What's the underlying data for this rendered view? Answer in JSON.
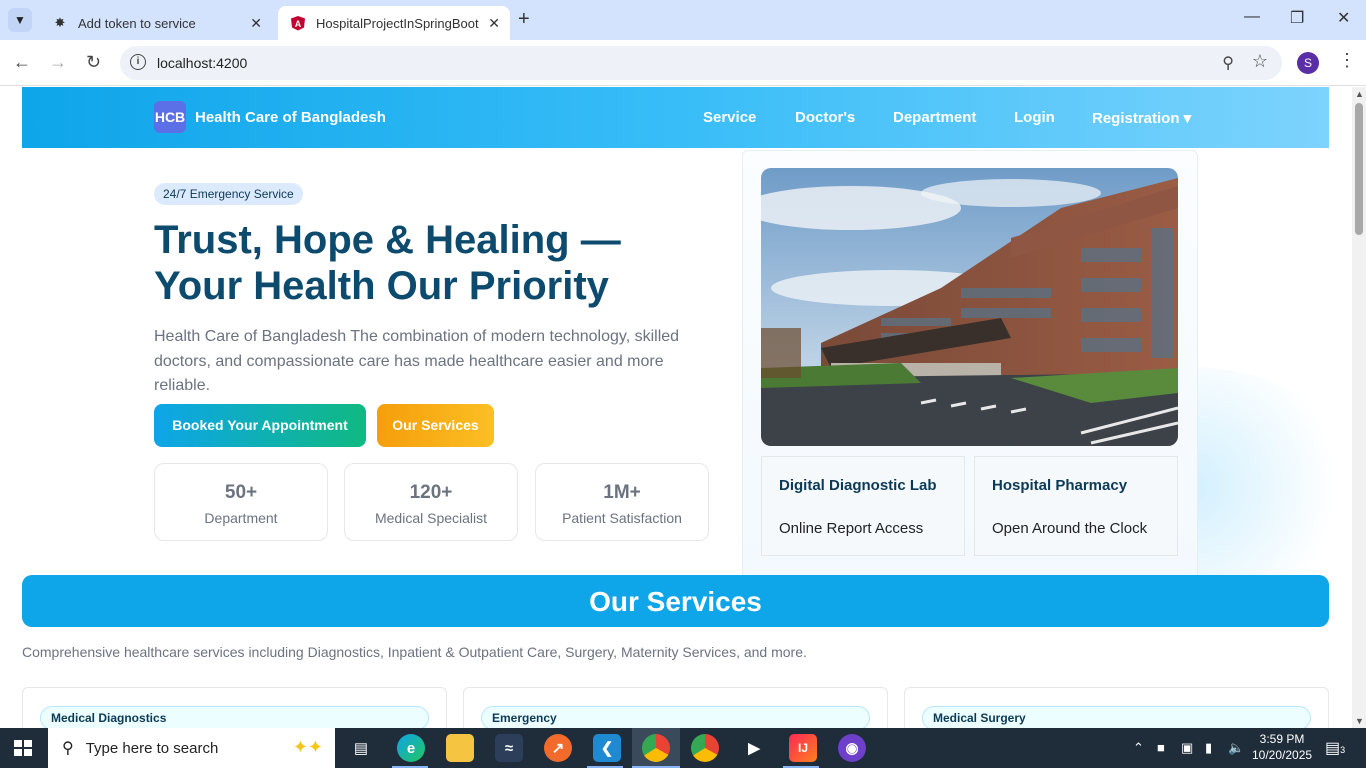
{
  "browser": {
    "tabs": [
      {
        "title": "Add token to service",
        "icon": "openai-icon",
        "active": false
      },
      {
        "title": "HospitalProjectInSpringBoot",
        "icon": "angular-icon",
        "active": true
      }
    ],
    "url": "localhost:4200",
    "profile_initial": "S"
  },
  "site": {
    "brand_logo": "HCB",
    "brand_name": "Health Care of Bangladesh",
    "nav": {
      "service": "Service",
      "doctors": "Doctor's",
      "department": "Department",
      "login": "Login",
      "registration": "Registration ▾"
    },
    "hero": {
      "badge": "24/7 Emergency Service",
      "title_line1": "Trust, Hope & Healing —",
      "title_line2": "Your Health Our Priority",
      "description": "Health Care of Bangladesh The combination of modern technology, skilled doctors, and compassionate care has made healthcare easier and more reliable.",
      "primary_button": "Booked Your Appointment",
      "secondary_button": "Our Services"
    },
    "stats": [
      {
        "value": "50+",
        "label": "Department"
      },
      {
        "value": "120+",
        "label": "Medical Specialist"
      },
      {
        "value": "1M+",
        "label": "Patient Satisfaction"
      }
    ],
    "features": [
      {
        "title": "Digital Diagnostic Lab",
        "desc": "Online Report Access"
      },
      {
        "title": "Hospital Pharmacy",
        "desc": "Open Around the Clock"
      }
    ],
    "services": {
      "heading": "Our Services",
      "description": "Comprehensive healthcare services including Diagnostics, Inpatient & Outpatient Care, Surgery, Maternity Services, and more.",
      "cards": [
        "Medical Diagnostics",
        "Emergency",
        "Medical Surgery"
      ]
    }
  },
  "taskbar": {
    "search_placeholder": "Type here to search",
    "time": "3:59 PM",
    "date": "10/20/2025",
    "notification_count": "3"
  },
  "colors": {
    "accent": "#0ea5e9",
    "title": "#0c4a6e",
    "secondary_button": "#f59e0b"
  }
}
